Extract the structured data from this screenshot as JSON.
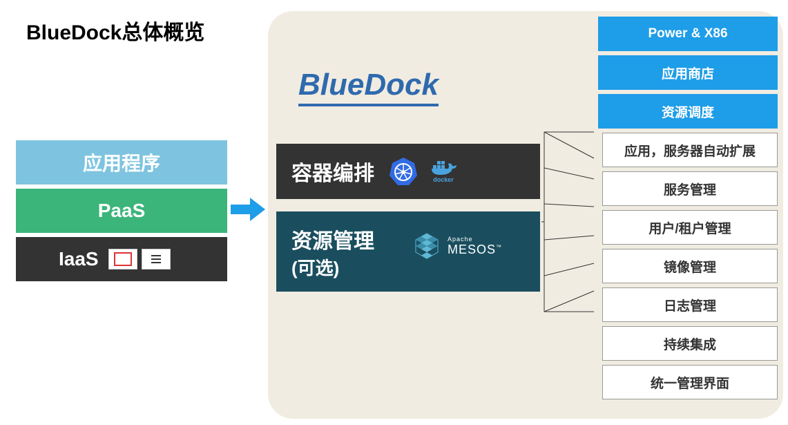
{
  "title": "BlueDock总体概览",
  "left": {
    "app": "应用程序",
    "paas": "PaaS",
    "iaas": "IaaS",
    "iaas_icons": [
      "openstack",
      "softlayer"
    ]
  },
  "bluedock_title": "BlueDock",
  "center": {
    "orchestration": "容器编排",
    "orch_icons": [
      "kubernetes",
      "docker"
    ],
    "resource_line1": "资源管理",
    "resource_line2": "(可选)",
    "resource_icon": "Apache MESOS"
  },
  "right_blue": [
    "Power & X86",
    "应用商店",
    "资源调度"
  ],
  "right_white": [
    "应用，服务器自动扩展",
    "服务管理",
    "用户/租户管理",
    "镜像管理",
    "日志管理",
    "持续集成",
    "统一管理界面"
  ]
}
